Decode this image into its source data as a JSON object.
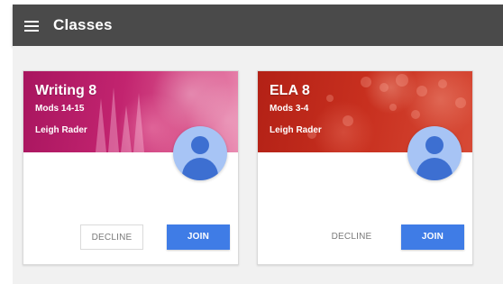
{
  "app": {
    "title": "Classes",
    "menu_icon": "hamburger-menu-icon",
    "colors": {
      "appbar": "#4a4a4a",
      "background": "#f1f1f1",
      "join_button": "#3f7ce6",
      "avatar_bg": "#a7c4f5",
      "avatar_fg": "#3d6fd1"
    }
  },
  "cards": [
    {
      "title": "Writing 8",
      "section": "Mods 14-15",
      "teacher": "Leigh Rader",
      "banner_color": "#c2246f",
      "decline_label": "DECLINE",
      "join_label": "JOIN",
      "avatar_icon": "person-avatar-icon"
    },
    {
      "title": "ELA 8",
      "section": "Mods 3-4",
      "teacher": "Leigh Rader",
      "banner_color": "#c8301f",
      "decline_label": "DECLINE",
      "join_label": "JOIN",
      "avatar_icon": "person-avatar-icon"
    }
  ]
}
